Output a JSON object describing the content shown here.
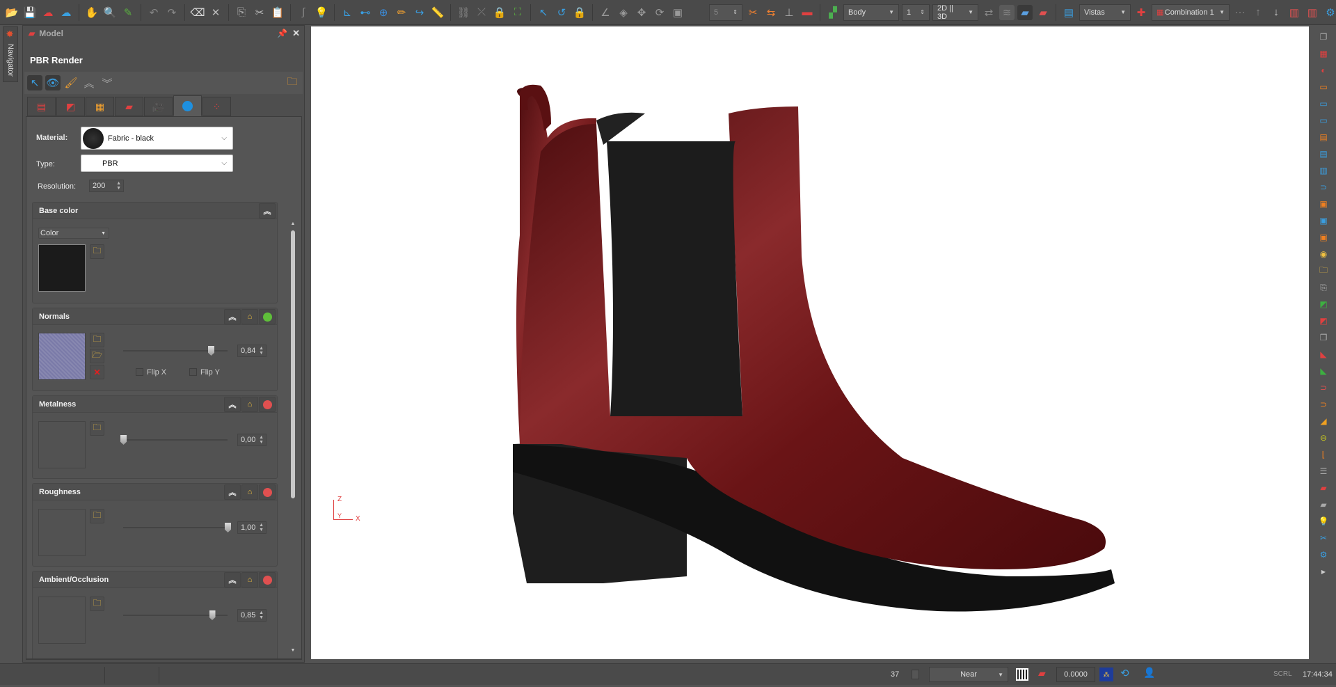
{
  "toolbar": {
    "body_select": "Body",
    "body_index": "1",
    "view_mode": "2D || 3D",
    "vistas": "Vistas",
    "combination": "Combination 1",
    "more": "···"
  },
  "navigator": {
    "label": "Navigator"
  },
  "panel": {
    "title": "Model",
    "section_title": "PBR Render",
    "material_label": "Material:",
    "material_value": "Fabric - black",
    "type_label": "Type:",
    "type_value": "PBR",
    "resolution_label": "Resolution:",
    "resolution_value": "200",
    "base_color": {
      "title": "Base color",
      "mode": "Color",
      "swatch": "#1b1b1b"
    },
    "normals": {
      "title": "Normals",
      "value": "0,84",
      "level": 0.84,
      "flip_x": "Flip X",
      "flip_y": "Flip Y",
      "status": "#5fbf3a"
    },
    "metalness": {
      "title": "Metalness",
      "value": "0,00",
      "level": 0.0,
      "status": "#e05050"
    },
    "roughness": {
      "title": "Roughness",
      "value": "1,00",
      "level": 1.0,
      "status": "#e05050"
    },
    "ambient": {
      "title": "Ambient/Occlusion",
      "value": "0,85",
      "level": 0.85,
      "status": "#e05050"
    }
  },
  "viewport": {
    "axis_z": "Z",
    "axis_y": "Y",
    "axis_x": "X",
    "leather": "#6a1416"
  },
  "status": {
    "count": "37",
    "near": "Near",
    "value": "0.0000",
    "scrl": "SCRL",
    "time": "17:44:34"
  }
}
